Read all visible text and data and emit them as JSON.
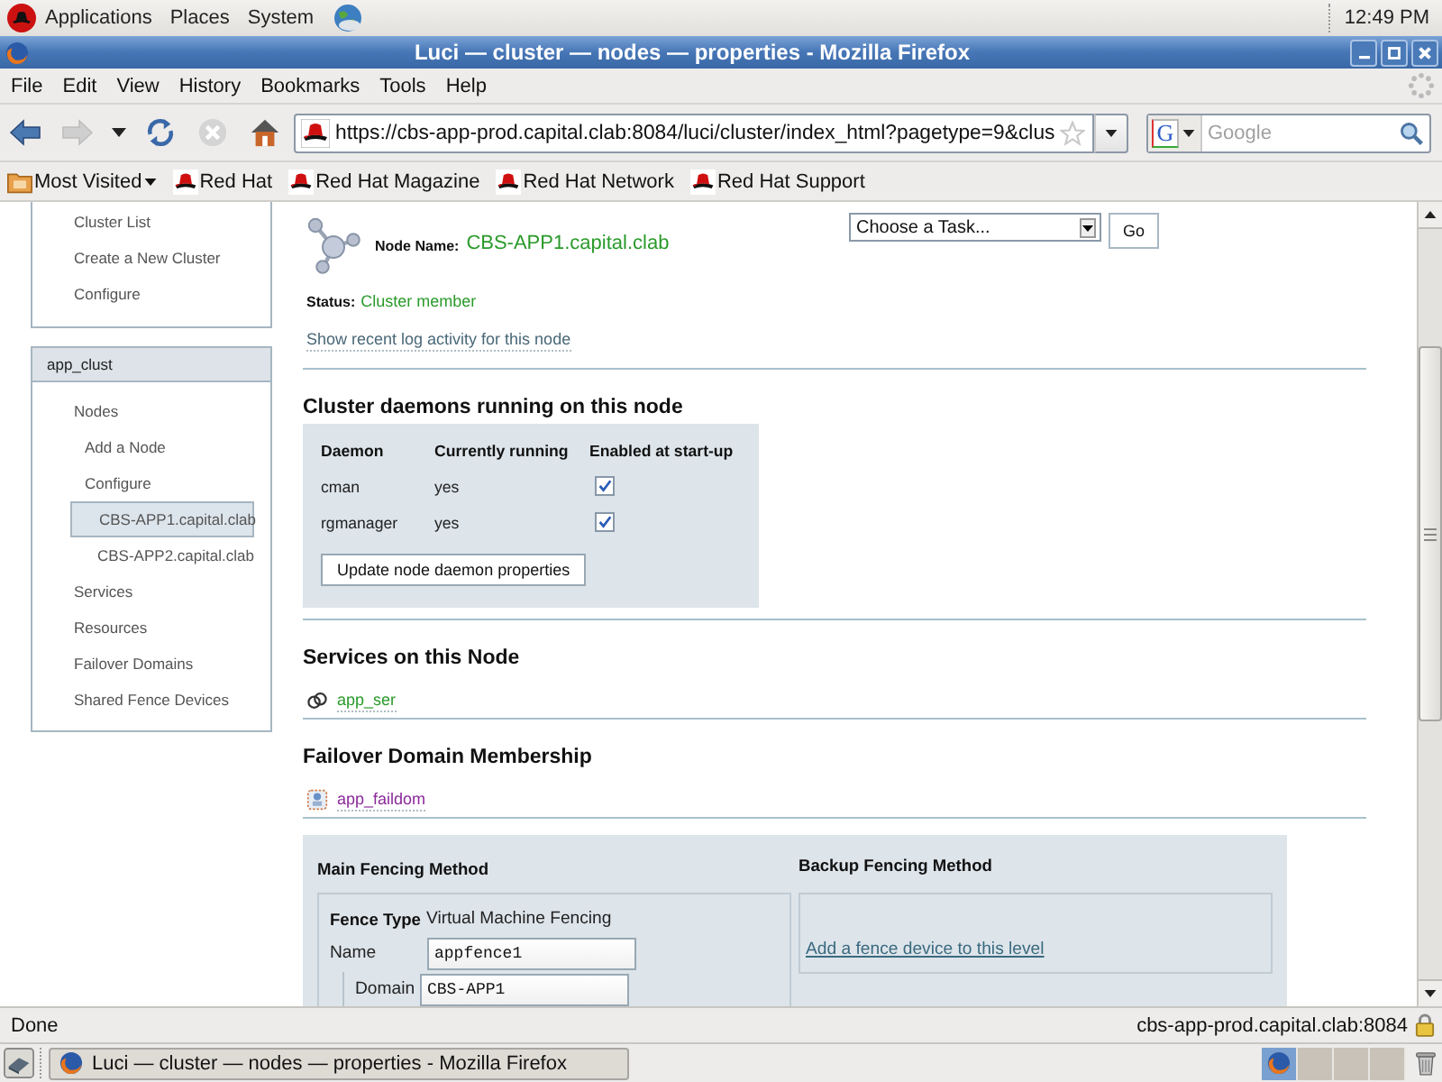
{
  "top_panel": {
    "menus": [
      "Applications",
      "Places",
      "System"
    ],
    "clock": "12:49 PM"
  },
  "window": {
    "title": "Luci — cluster — nodes — properties - Mozilla Firefox"
  },
  "menu_bar": [
    "File",
    "Edit",
    "View",
    "History",
    "Bookmarks",
    "Tools",
    "Help"
  ],
  "nav_buttons": [
    {
      "kind": "back",
      "disabled": false
    },
    {
      "kind": "forward",
      "disabled": true
    },
    {
      "kind": "history",
      "disabled": false
    },
    {
      "kind": "reload",
      "disabled": false
    },
    {
      "kind": "stop",
      "disabled": true
    },
    {
      "kind": "home",
      "disabled": false
    }
  ],
  "address_bar": {
    "url": "https://cbs-app-prod.capital.clab:8084/luci/cluster/index_html?pagetype=9&clus",
    "search_engine": "G",
    "search_placeholder": "Google"
  },
  "bookmarks": [
    {
      "kind": "folder",
      "label": "Most Visited"
    },
    {
      "kind": "site",
      "label": "Red Hat"
    },
    {
      "kind": "site",
      "label": "Red Hat Magazine"
    },
    {
      "kind": "site",
      "label": "Red Hat Network"
    },
    {
      "kind": "site",
      "label": "Red Hat Support"
    }
  ],
  "sidebar": {
    "links": [
      "Cluster List",
      "Create a New Cluster",
      "Configure"
    ],
    "cluster": {
      "title": "app_clust",
      "items": [
        {
          "label": "Nodes",
          "selected": false,
          "children": [
            {
              "label": "Add a Node",
              "selected": false
            },
            {
              "label": "Configure",
              "selected": false,
              "children": [
                {
                  "label": "CBS-APP1.capital.clab",
                  "selected": true
                },
                {
                  "label": "CBS-APP2.capital.clab",
                  "selected": false
                }
              ]
            }
          ]
        },
        {
          "label": "Services",
          "selected": false
        },
        {
          "label": "Resources",
          "selected": false
        },
        {
          "label": "Failover Domains",
          "selected": false
        },
        {
          "label": "Shared Fence Devices",
          "selected": false
        }
      ]
    }
  },
  "node": {
    "name_label": "Node Name:",
    "name": "CBS-APP1.capital.clab",
    "status_label": "Status:",
    "status": "Cluster member",
    "log_link": "Show recent log activity for this node"
  },
  "task": {
    "select": "Choose a Task...",
    "button": "Go"
  },
  "daemons": {
    "title": "Cluster daemons running on this node",
    "columns": [
      "Daemon",
      "Currently running",
      "Enabled at start-up"
    ],
    "rows": [
      {
        "name": "cman",
        "running": "yes",
        "enabled": true
      },
      {
        "name": "rgmanager",
        "running": "yes",
        "enabled": true
      }
    ],
    "button": "Update node daemon properties"
  },
  "services": {
    "title": "Services on this Node",
    "items": [
      "app_ser"
    ]
  },
  "failover_domains": {
    "title": "Failover Domain Membership",
    "items": [
      "app_faildom"
    ]
  },
  "fencing": {
    "main": {
      "title": "Main Fencing Method",
      "type_label": "Fence Type",
      "type": "Virtual Machine Fencing",
      "name_label": "Name",
      "name": "appfence1",
      "domain_label": "Domain",
      "domain": "CBS-APP1"
    },
    "backup": {
      "title": "Backup Fencing Method",
      "link": "Add a fence device to this level"
    }
  },
  "status_bar": {
    "text": "Done",
    "host": "cbs-app-prod.capital.clab:8084"
  },
  "taskbar": {
    "window_button": "Luci — cluster — nodes — properties - Mozilla Firefox",
    "workspaces": [
      {
        "selected": true
      },
      {
        "selected": false
      },
      {
        "selected": false
      },
      {
        "selected": false
      }
    ]
  }
}
